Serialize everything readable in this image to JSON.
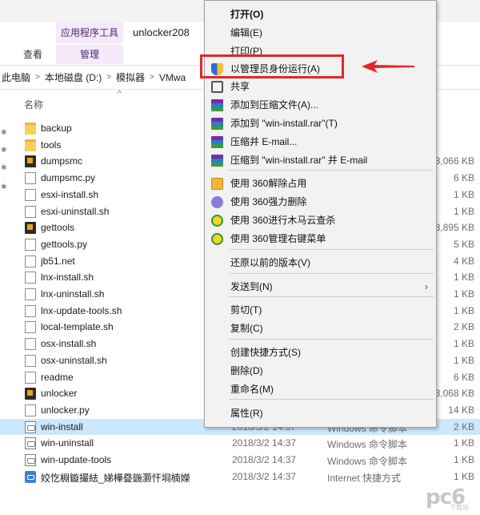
{
  "ribbon": {
    "context_tab_header": "应用程序工具",
    "window_title": "unlocker208",
    "tabs": [
      {
        "label": "查看"
      },
      {
        "label": "管理"
      }
    ]
  },
  "address_bar": {
    "crumbs": [
      "此电脑",
      "本地磁盘 (D:)",
      "模拟器",
      "VMwa"
    ]
  },
  "columns": {
    "name": "名称"
  },
  "files": [
    {
      "name": "backup",
      "date": "",
      "type": "",
      "size": "",
      "icon": "folder-icon"
    },
    {
      "name": "tools",
      "date": "",
      "type": "",
      "size": "",
      "icon": "folder-icon"
    },
    {
      "name": "dumpsmc",
      "date": "",
      "type": "",
      "size": "3,066 KB",
      "icon": "vm-app-icon"
    },
    {
      "name": "dumpsmc.py",
      "date": "",
      "type": "",
      "size": "6 KB",
      "icon": "document-icon"
    },
    {
      "name": "esxi-install.sh",
      "date": "",
      "type": "",
      "size": "1 KB",
      "icon": "document-icon"
    },
    {
      "name": "esxi-uninstall.sh",
      "date": "",
      "type": "",
      "size": "1 KB",
      "icon": "document-icon"
    },
    {
      "name": "gettools",
      "date": "",
      "type": "",
      "size": "3,895 KB",
      "icon": "vm-app-icon"
    },
    {
      "name": "gettools.py",
      "date": "",
      "type": "",
      "size": "5 KB",
      "icon": "document-icon"
    },
    {
      "name": "jb51.net",
      "date": "",
      "type": "",
      "size": "4 KB",
      "icon": "document-icon"
    },
    {
      "name": "lnx-install.sh",
      "date": "",
      "type": "",
      "size": "1 KB",
      "icon": "document-icon"
    },
    {
      "name": "lnx-uninstall.sh",
      "date": "",
      "type": "",
      "size": "1 KB",
      "icon": "document-icon"
    },
    {
      "name": "lnx-update-tools.sh",
      "date": "",
      "type": "",
      "size": "1 KB",
      "icon": "document-icon"
    },
    {
      "name": "local-template.sh",
      "date": "",
      "type": "",
      "size": "2 KB",
      "icon": "document-icon"
    },
    {
      "name": "osx-install.sh",
      "date": "",
      "type": "",
      "size": "1 KB",
      "icon": "document-icon"
    },
    {
      "name": "osx-uninstall.sh",
      "date": "",
      "type": "",
      "size": "1 KB",
      "icon": "document-icon"
    },
    {
      "name": "readme",
      "date": "",
      "type": "",
      "size": "6 KB",
      "icon": "document-icon"
    },
    {
      "name": "unlocker",
      "date": "",
      "type": "",
      "size": "3,068 KB",
      "icon": "vm-app-icon"
    },
    {
      "name": "unlocker.py",
      "date": "",
      "type": "",
      "size": "14 KB",
      "icon": "document-icon"
    },
    {
      "name": "win-install",
      "date": "2018/3/2 14:37",
      "type": "Windows 命令脚本",
      "size": "2 KB",
      "icon": "batch-script-icon",
      "selected": true
    },
    {
      "name": "win-uninstall",
      "date": "2018/3/2 14:37",
      "type": "Windows 命令脚本",
      "size": "1 KB",
      "icon": "batch-script-icon"
    },
    {
      "name": "win-update-tools",
      "date": "2018/3/2 14:37",
      "type": "Windows 命令脚本",
      "size": "1 KB",
      "icon": "batch-script-icon"
    },
    {
      "name": "姣忔棩鏇撮紶_娣樺疂鍦灏忓埛楠嬫",
      "date": "2018/3/2 14:37",
      "type": "Internet 快捷方式",
      "size": "1 KB",
      "icon": "shortcut-icon"
    }
  ],
  "context_menu": {
    "items": [
      {
        "label": "打开(O)",
        "icon": "",
        "bold": true
      },
      {
        "label": "编辑(E)",
        "icon": ""
      },
      {
        "label": "打印(P)",
        "icon": ""
      },
      {
        "label": "以管理员身份运行(A)",
        "icon": "shield-icon"
      },
      {
        "label": "共享",
        "icon": "share-icon"
      },
      {
        "label": "添加到压缩文件(A)...",
        "icon": "winrar-icon"
      },
      {
        "label": "添加到 \"win-install.rar\"(T)",
        "icon": "winrar-icon"
      },
      {
        "label": "压缩并 E-mail...",
        "icon": "winrar-icon"
      },
      {
        "label": "压缩到 \"win-install.rar\" 并 E-mail",
        "icon": "winrar-icon"
      },
      {
        "label": "使用 360解除占用",
        "icon": "360-unlock-icon"
      },
      {
        "label": "使用 360强力删除",
        "icon": "360-delete-icon"
      },
      {
        "label": "使用 360进行木马云查杀",
        "icon": "360-scan-icon"
      },
      {
        "label": "使用 360管理右键菜单",
        "icon": "360-manage-icon"
      },
      {
        "label": "还原以前的版本(V)",
        "icon": ""
      },
      {
        "label": "发送到(N)",
        "icon": "",
        "submenu": true
      },
      {
        "label": "剪切(T)",
        "icon": ""
      },
      {
        "label": "复制(C)",
        "icon": ""
      },
      {
        "label": "创建快捷方式(S)",
        "icon": ""
      },
      {
        "label": "删除(D)",
        "icon": ""
      },
      {
        "label": "重命名(M)",
        "icon": ""
      },
      {
        "label": "属性(R)",
        "icon": ""
      }
    ],
    "submenu_arrow": "›"
  },
  "annotation": {
    "highlight_color": "#e3262a"
  },
  "watermark": {
    "text": "pc6",
    "sub": "下载站"
  },
  "colors": {
    "selection": "#cce8ff",
    "context_tab": "#f5e9fa",
    "menu_bg": "#f2f2f2"
  }
}
